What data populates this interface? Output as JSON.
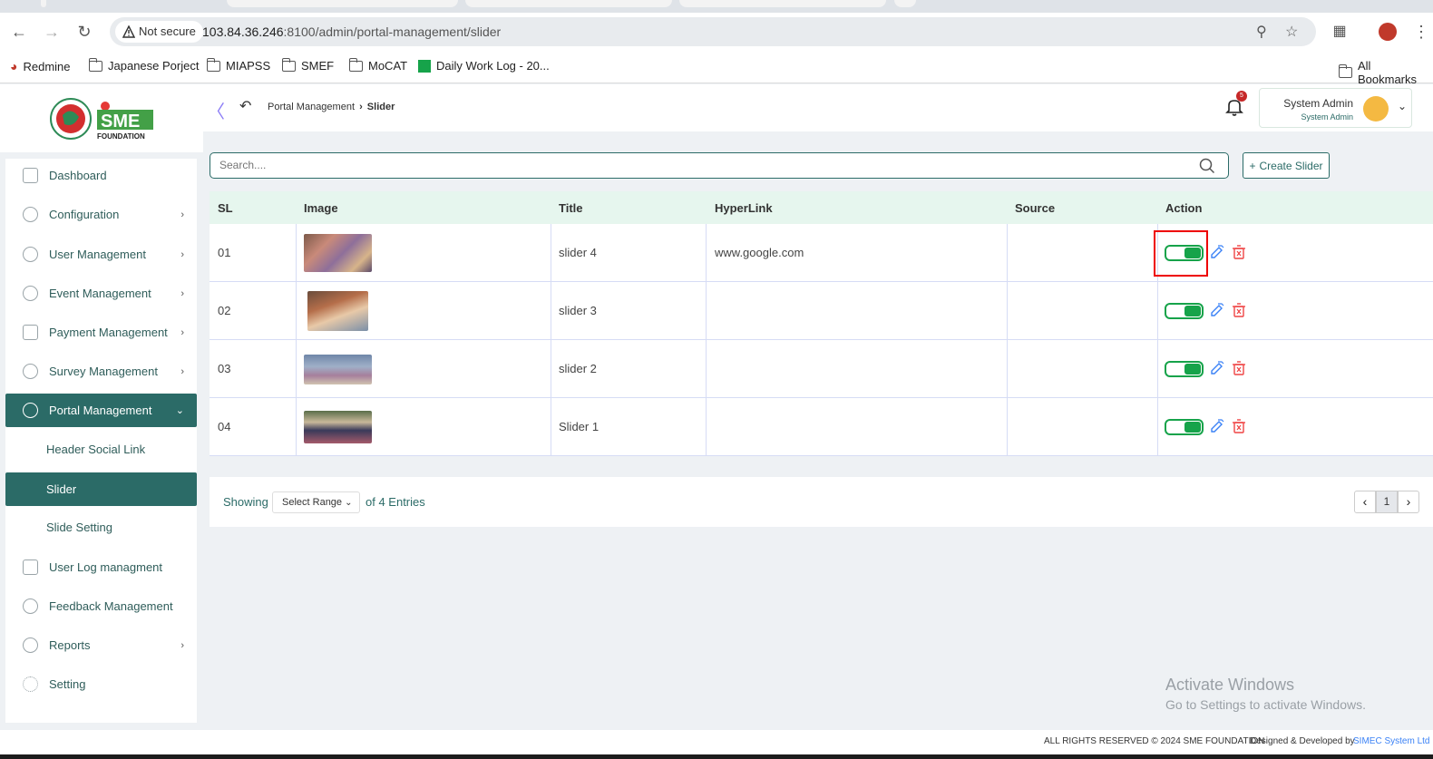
{
  "browser": {
    "security_label": "Not secure",
    "url_host": "103.84.36.246",
    "url_rest": ":8100/admin/portal-management/slider",
    "bookmarks": [
      "Redmine",
      "Japanese Porject",
      "MIAPSS",
      "SMEF",
      "MoCAT",
      "Daily Work Log - 20...",
      "All Bookmarks"
    ]
  },
  "logo": {
    "text": "SME",
    "subtext": "FOUNDATION"
  },
  "sidebar": {
    "items": [
      {
        "label": "Dashboard"
      },
      {
        "label": "Configuration"
      },
      {
        "label": "User Management"
      },
      {
        "label": "Event Management"
      },
      {
        "label": "Payment Management"
      },
      {
        "label": "Survey Management"
      },
      {
        "label": "Portal Management"
      },
      {
        "label": "Header Social Link"
      },
      {
        "label": "Slider"
      },
      {
        "label": "Slide Setting"
      },
      {
        "label": "User Log managment"
      },
      {
        "label": "Feedback Management"
      },
      {
        "label": "Reports"
      },
      {
        "label": "Setting"
      }
    ]
  },
  "header": {
    "breadcrumb_parent": "Portal Management",
    "breadcrumb_current": "Slider",
    "notification_count": "5",
    "user_name": "System Admin",
    "user_role": "System Admin"
  },
  "search": {
    "placeholder": "Search...."
  },
  "create_button": "Create Slider",
  "table": {
    "columns": [
      "SL",
      "Image",
      "Title",
      "HyperLink",
      "Source",
      "Action"
    ],
    "rows": [
      {
        "sl": "01",
        "title": "slider 4",
        "hyperlink": "www.google.com",
        "source": ""
      },
      {
        "sl": "02",
        "title": "slider 3",
        "hyperlink": "",
        "source": ""
      },
      {
        "sl": "03",
        "title": "slider 2",
        "hyperlink": "",
        "source": ""
      },
      {
        "sl": "04",
        "title": "Slider 1",
        "hyperlink": "",
        "source": ""
      }
    ]
  },
  "pagination": {
    "showing_label": "Showing",
    "range_select": "Select Range",
    "entries_label": "of 4 Entries",
    "current_page": "1"
  },
  "footer": {
    "copyright": "ALL RIGHTS RESERVED © 2024 SME FOUNDATION",
    "designed_by": "Designed & Developed by",
    "developer": "SIMEC System Ltd"
  },
  "watermark": {
    "line1": "Activate Windows",
    "line2": "Go to Settings to activate Windows."
  }
}
